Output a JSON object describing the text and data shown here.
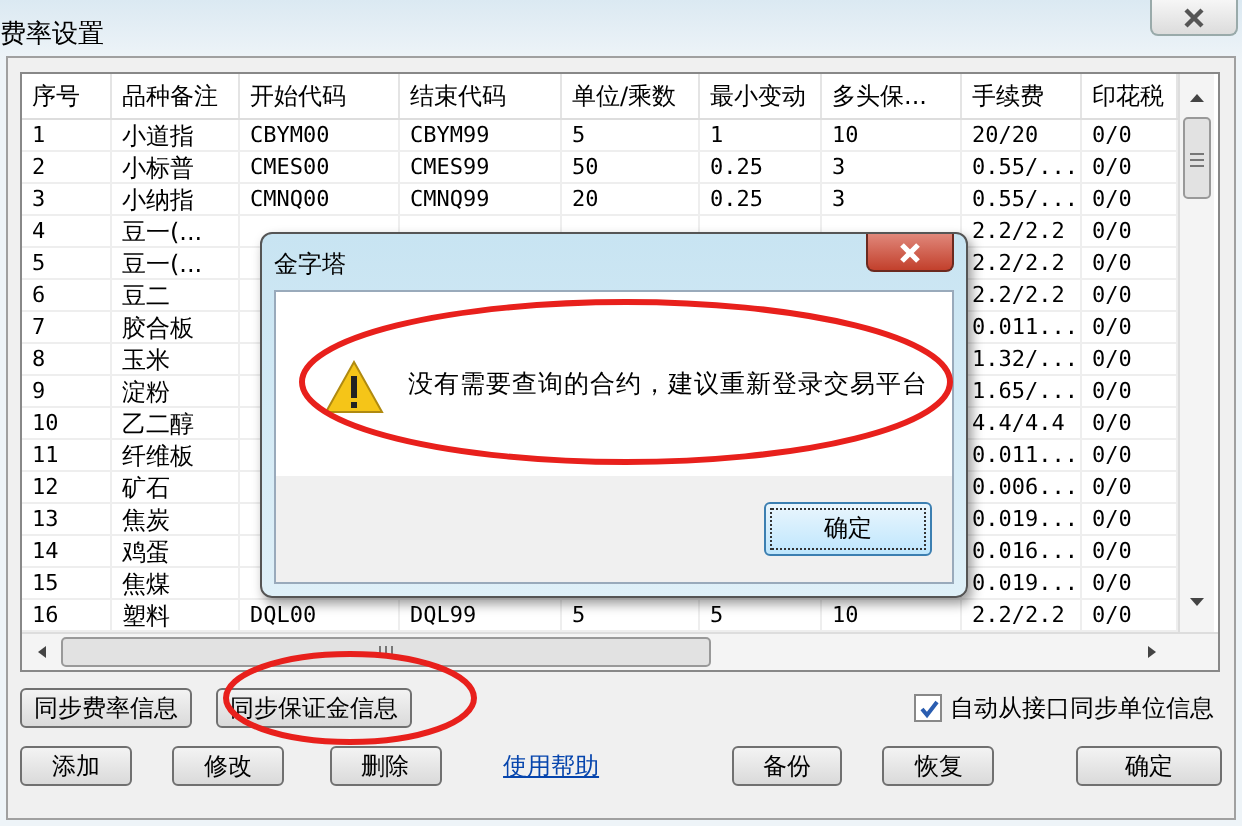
{
  "window": {
    "title": "费率设置"
  },
  "table": {
    "columns": [
      "序号",
      "品种备注",
      "开始代码",
      "结束代码",
      "单位/乘数",
      "最小变动",
      "多头保...",
      "手续费",
      "印花税"
    ],
    "rows": [
      [
        "1",
        "小道指",
        "CBYM00",
        "CBYM99",
        "5",
        "1",
        "10",
        "20/20",
        "0/0"
      ],
      [
        "2",
        "小标普",
        "CMES00",
        "CMES99",
        "50",
        "0.25",
        "3",
        "0.55/...",
        "0/0"
      ],
      [
        "3",
        "小纳指",
        "CMNQ00",
        "CMNQ99",
        "20",
        "0.25",
        "3",
        "0.55/...",
        "0/0"
      ],
      [
        "4",
        "豆一(...",
        null,
        null,
        null,
        null,
        null,
        "2.2/2.2",
        "0/0"
      ],
      [
        "5",
        "豆一(...",
        null,
        null,
        null,
        null,
        null,
        "2.2/2.2",
        "0/0"
      ],
      [
        "6",
        "豆二",
        null,
        null,
        null,
        null,
        null,
        "2.2/2.2",
        "0/0"
      ],
      [
        "7",
        "胶合板",
        null,
        null,
        null,
        null,
        null,
        "0.011...",
        "0/0"
      ],
      [
        "8",
        "玉米",
        null,
        null,
        null,
        null,
        null,
        "1.32/...",
        "0/0"
      ],
      [
        "9",
        "淀粉",
        null,
        null,
        null,
        null,
        null,
        "1.65/...",
        "0/0"
      ],
      [
        "10",
        "乙二醇",
        null,
        null,
        null,
        null,
        null,
        "4.4/4.4",
        "0/0"
      ],
      [
        "11",
        "纤维板",
        null,
        null,
        null,
        null,
        null,
        "0.011...",
        "0/0"
      ],
      [
        "12",
        "矿石",
        null,
        null,
        null,
        null,
        null,
        "0.006...",
        "0/0"
      ],
      [
        "13",
        "焦炭",
        null,
        null,
        null,
        null,
        null,
        "0.019...",
        "0/0"
      ],
      [
        "14",
        "鸡蛋",
        null,
        null,
        null,
        null,
        null,
        "0.016...",
        "0/0"
      ],
      [
        "15",
        "焦煤",
        null,
        null,
        null,
        null,
        null,
        "0.019...",
        "0/0"
      ],
      [
        "16",
        "塑料",
        "DQL00",
        "DQL99",
        "5",
        "5",
        "10",
        "2.2/2.2",
        "0/0"
      ]
    ]
  },
  "sync_buttons": [
    "同步费率信息",
    "同步保证金信息"
  ],
  "auto_sync": {
    "label": "自动从接口同步单位信息",
    "checked": true
  },
  "actions": [
    {
      "kind": "button",
      "label": "添加"
    },
    {
      "kind": "button",
      "label": "修改"
    },
    {
      "kind": "button",
      "label": "删除"
    },
    {
      "kind": "link",
      "label": "使用帮助"
    },
    {
      "kind": "button",
      "label": "备份"
    },
    {
      "kind": "button",
      "label": "恢复"
    },
    {
      "kind": "button",
      "label": "确定"
    }
  ],
  "dialog": {
    "title": "金字塔",
    "message": "没有需要查询的合约，建议重新登录交易平台",
    "button": "确定"
  }
}
